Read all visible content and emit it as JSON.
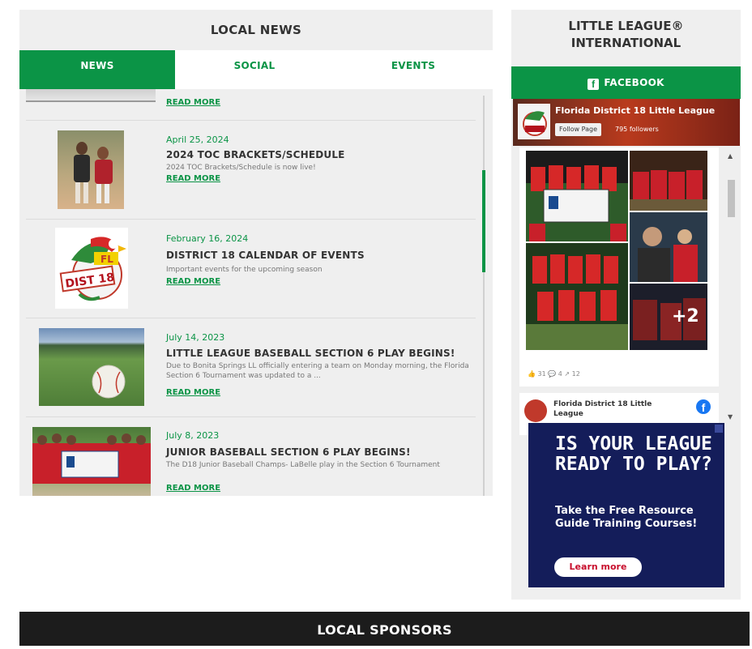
{
  "news": {
    "title": "LOCAL NEWS",
    "tabs": [
      {
        "label": "NEWS"
      },
      {
        "label": "SOCIAL"
      },
      {
        "label": "EVENTS"
      }
    ],
    "read_more": "READ MORE",
    "items": [
      {
        "date": "April 25, 2024",
        "title": "2024 TOC BRACKETS/SCHEDULE",
        "desc": "2024 TOC Brackets/Schedule is now live!",
        "read_more": "READ MORE"
      },
      {
        "date": "February 16, 2024",
        "title": "DISTRICT 18 CALENDAR OF EVENTS",
        "desc": "Important events for the upcoming season",
        "read_more": "READ MORE"
      },
      {
        "date": "July 14, 2023",
        "title": "LITTLE LEAGUE BASEBALL SECTION 6 PLAY BEGINS!",
        "desc": "Due to Bonita Springs LL officially entering a team on Monday morning, the Florida Section 6 Tournament was updated to a ...",
        "read_more": "READ MORE"
      },
      {
        "date": "July 8, 2023",
        "title": "JUNIOR BASEBALL SECTION 6 PLAY BEGINS!",
        "desc": "The D18 Junior Baseball Champs- LaBelle play in the Section 6 Tournament",
        "read_more": "READ MORE"
      }
    ],
    "logo_text": {
      "fl": "FL",
      "dist": "DIST 18"
    }
  },
  "right": {
    "title_line1": "LITTLE LEAGUE®",
    "title_line2": "INTERNATIONAL",
    "facebook_label": "FACEBOOK",
    "fb_icon": "f",
    "feed": {
      "page_name": "Florida District 18 Little League",
      "follow_label": "Follow Page",
      "followers": "795 followers",
      "more_photos": "+2",
      "reactions": "👍 31   💬 4   ↗ 12",
      "post2_name": "Florida District 18 Little League",
      "post2_icon": "f"
    },
    "ad": {
      "headline": "IS YOUR LEAGUE READY TO PLAY?",
      "sub": "Take the Free Resource Guide Training Courses!",
      "button": "Learn more"
    }
  },
  "sponsors": {
    "title": "LOCAL SPONSORS"
  },
  "colors": {
    "accent": "#0b9446",
    "dark": "#1c1c1c",
    "ad_bg": "#141d5a"
  }
}
